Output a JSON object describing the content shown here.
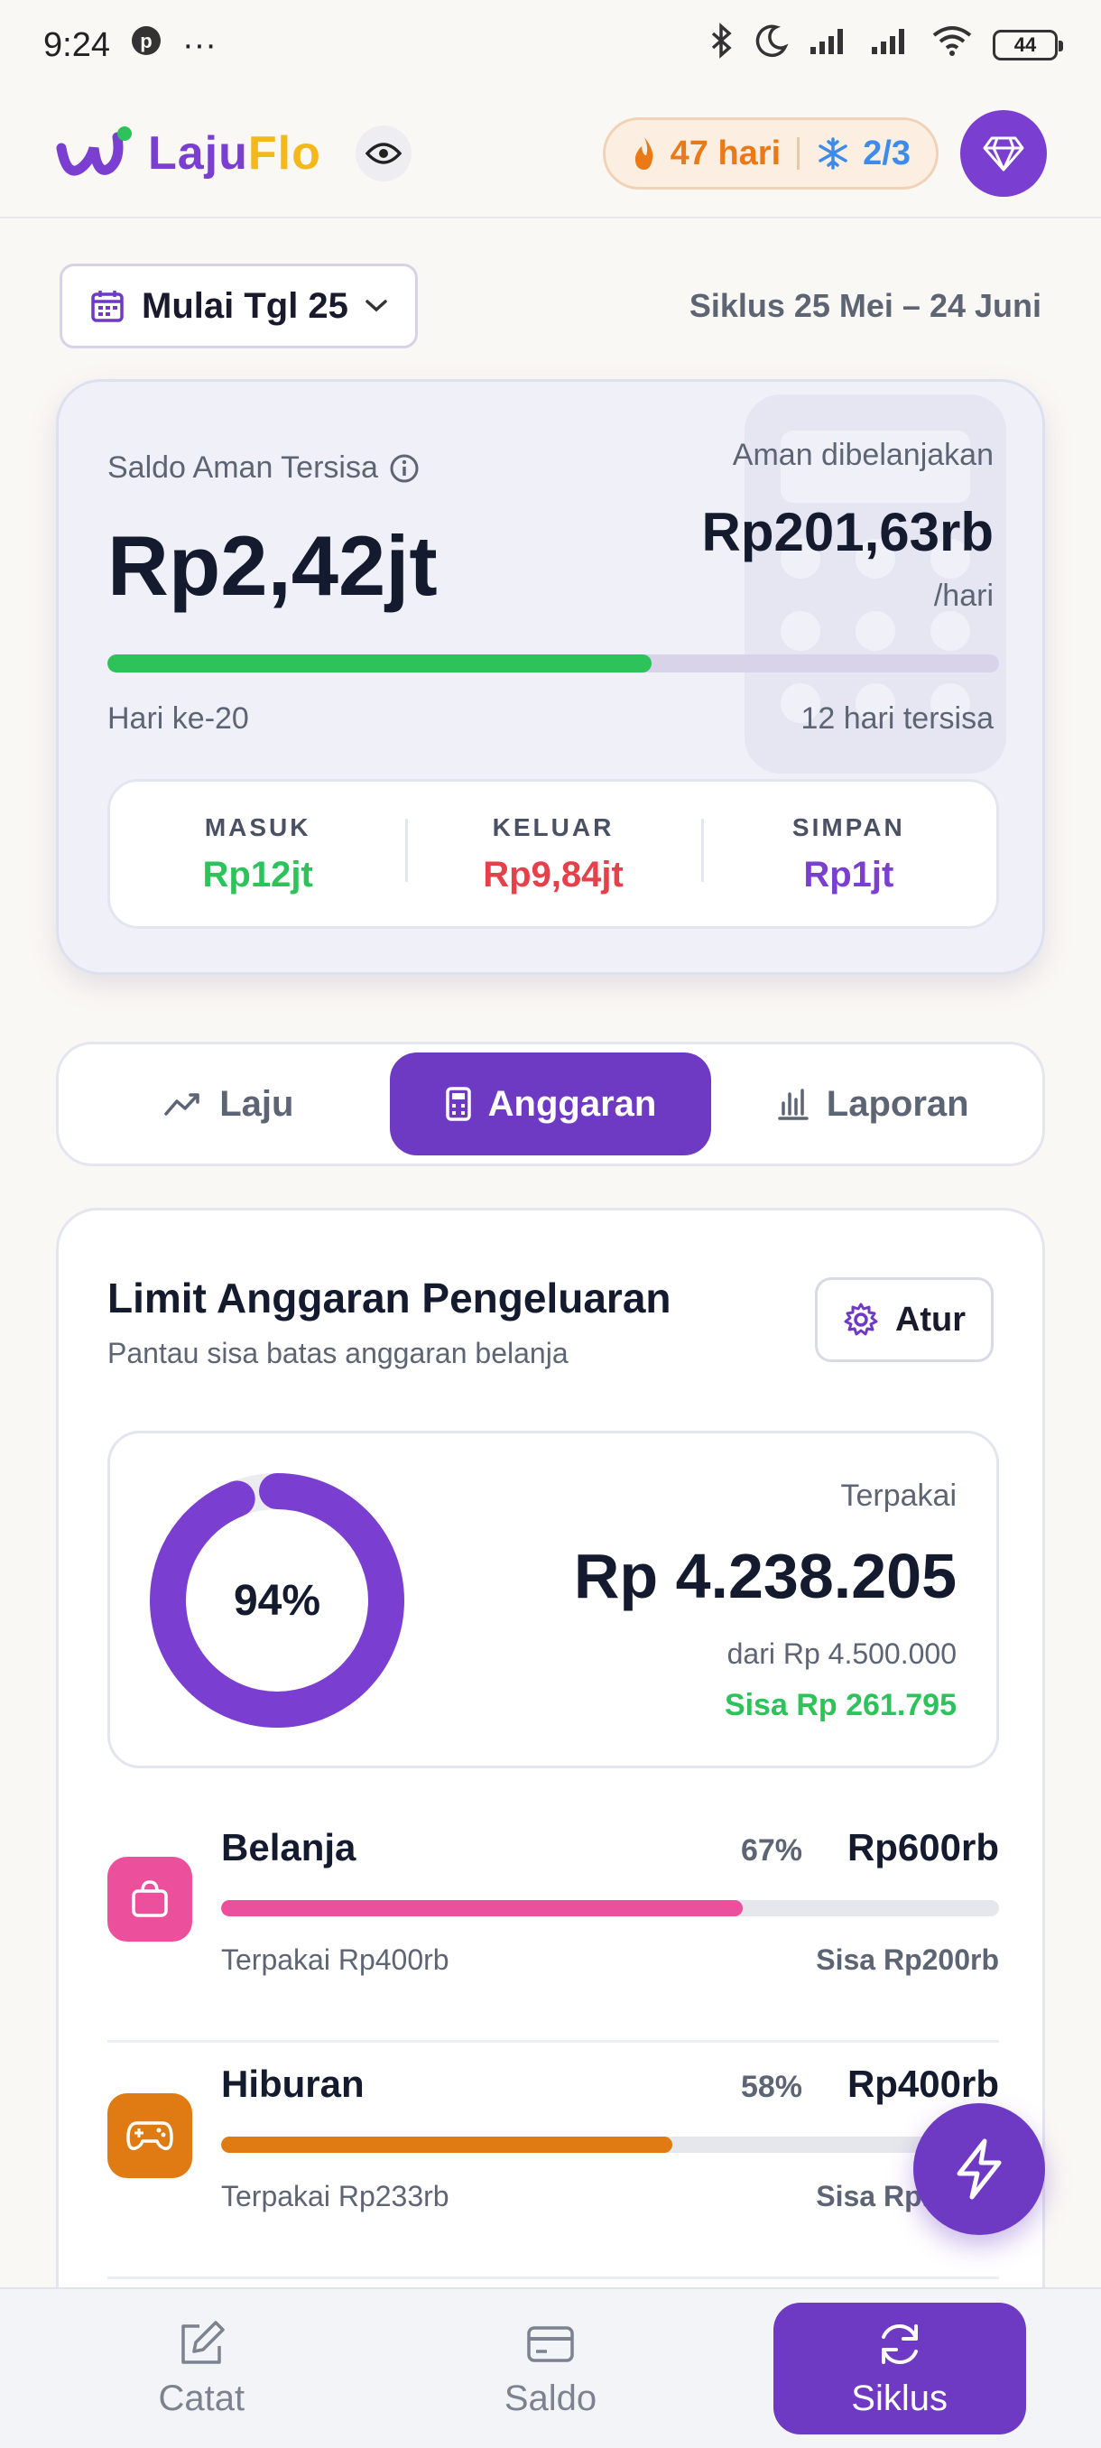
{
  "status_bar": {
    "time": "9:24",
    "more": "···",
    "battery": "44"
  },
  "header": {
    "logo_laju": "Laju",
    "logo_flo": "Flo",
    "streak_days": "47 hari",
    "freeze_count": "2/3"
  },
  "cycle": {
    "selector_label": "Mulai Tgl 25",
    "range": "Siklus 25 Mei – 24 Juni"
  },
  "summary": {
    "saldo_label": "Saldo Aman Tersisa",
    "saldo_value": "Rp2,42jt",
    "aman_label": "Aman dibelanjakan",
    "aman_value": "Rp201,63rb",
    "aman_unit": "/hari",
    "cycle_progress_fraction": 0.61,
    "day_label": "Hari ke-20",
    "remaining_label": "12 hari tersisa",
    "flows": [
      {
        "title": "MASUK",
        "value": "Rp12jt",
        "color": "#2dc35a"
      },
      {
        "title": "KELUAR",
        "value": "Rp9,84jt",
        "color": "#e5414a"
      },
      {
        "title": "SIMPAN",
        "value": "Rp1jt",
        "color": "#7a3fd0"
      }
    ]
  },
  "tabs": [
    {
      "label": "Laju",
      "active": false
    },
    {
      "label": "Anggaran",
      "active": true
    },
    {
      "label": "Laporan",
      "active": false
    }
  ],
  "budget": {
    "title": "Limit Anggaran Pengeluaran",
    "subtitle": "Pantau sisa batas anggaran belanja",
    "settings_label": "Atur",
    "usage_percent_label": "94%",
    "usage_fraction": 0.94,
    "used_label": "Terpakai",
    "used_value": "Rp 4.238.205",
    "used_of": "dari Rp 4.500.000",
    "used_left": "Sisa Rp 261.795",
    "accent": "#7a3fd0",
    "categories": [
      {
        "name": "Belanja",
        "percent": "67%",
        "fraction": 0.67,
        "limit": "Rp600rb",
        "used": "Terpakai Rp400rb",
        "left": "Sisa Rp200rb",
        "color": "#ec4f9b",
        "icon": "shopping-bag-icon"
      },
      {
        "name": "Hiburan",
        "percent": "58%",
        "fraction": 0.58,
        "limit": "Rp400rb",
        "used": "Terpakai Rp233rb",
        "left": "Sisa Rp167rb",
        "color": "#e07a12",
        "icon": "gamepad-icon"
      }
    ]
  },
  "bottom_nav": [
    {
      "label": "Catat",
      "active": false
    },
    {
      "label": "Saldo",
      "active": false
    },
    {
      "label": "Siklus",
      "active": true
    }
  ]
}
